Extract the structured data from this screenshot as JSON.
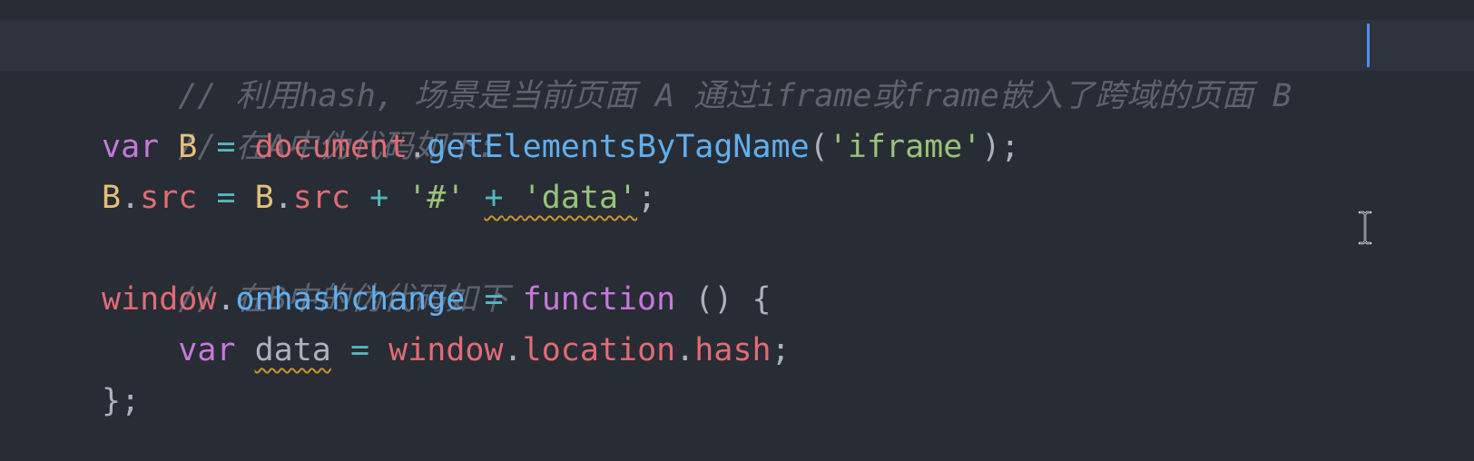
{
  "editor": {
    "lines": [
      {
        "comment": "// 利用hash, 场景是当前页面 A 通过iframe或frame嵌入了跨域的页面 B"
      },
      {
        "comment": "// 在A中伪代码如下:"
      },
      {
        "kw": "var",
        "name": "B",
        "eq": "=",
        "obj": "document",
        "dot": ".",
        "fn": "getElementsByTagName",
        "open": "(",
        "str": "'iframe'",
        "close": ");"
      },
      {
        "obj1": "B",
        "dot1": ".",
        "prop1": "src",
        "eq": "=",
        "obj2": "B",
        "dot2": ".",
        "prop2": "src",
        "plus1": "+",
        "str1": "'#'",
        "plus2": "+",
        "str2": "'data'",
        "semi": ";"
      },
      {
        "comment": "// 在B中的伪代码如下"
      },
      {
        "obj": "window",
        "dot": ".",
        "fn": "onhashchange",
        "eq": "=",
        "kw": "function",
        "parens": "()",
        "brace": "{"
      },
      {
        "indent": "    ",
        "kw": "var",
        "name": "data",
        "eq": "=",
        "obj": "window",
        "dot1": ".",
        "prop1": "location",
        "dot2": ".",
        "prop2": "hash",
        "semi": ";"
      },
      {
        "close": "};"
      }
    ]
  },
  "colors": {
    "background": "#282c34",
    "comment": "#5c6370",
    "keyword": "#c678dd",
    "variable": "#e5c07b",
    "object": "#e06c75",
    "function": "#61afef",
    "string": "#98c379",
    "operator": "#56b6c2"
  },
  "icons": {
    "text_cursor": "text-cursor-icon"
  }
}
